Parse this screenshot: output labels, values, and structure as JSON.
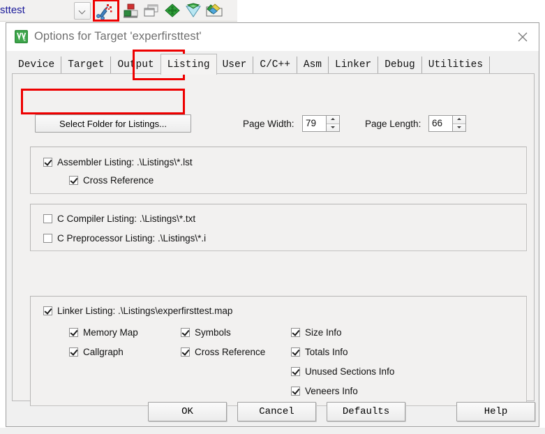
{
  "toolbar": {
    "target_combo_value": "sttest",
    "dropdown_icon": "chevron-down-icon",
    "icons": [
      {
        "name": "target-options-wand-icon",
        "highlighted": true
      },
      {
        "name": "manage-project-items-icon",
        "highlighted": false
      },
      {
        "name": "multi-project-icon",
        "highlighted": false
      },
      {
        "name": "pack-installer-green-icon",
        "highlighted": false
      },
      {
        "name": "configuration-wizard-icon",
        "highlighted": false
      },
      {
        "name": "open-pack-folder-icon",
        "highlighted": false
      }
    ]
  },
  "dialog": {
    "icon": "uvision-app-icon",
    "title": "Options for Target 'experfirsttest'",
    "close_label": "close-icon",
    "tabs": [
      {
        "label": "Device",
        "selected": false
      },
      {
        "label": "Target",
        "selected": false
      },
      {
        "label": "Output",
        "selected": false
      },
      {
        "label": "Listing",
        "selected": true
      },
      {
        "label": "User",
        "selected": false
      },
      {
        "label": "C/C++",
        "selected": false
      },
      {
        "label": "Asm",
        "selected": false
      },
      {
        "label": "Linker",
        "selected": false
      },
      {
        "label": "Debug",
        "selected": false
      },
      {
        "label": "Utilities",
        "selected": false
      }
    ],
    "listing": {
      "select_folder_button": "Select Folder for Listings...",
      "page_width_label": "Page Width:",
      "page_width_value": "79",
      "page_length_label": "Page Length:",
      "page_length_value": "66",
      "assembler_group": {
        "assembler_listing_label": "Assembler Listing:  .\\Listings\\*.lst",
        "assembler_listing_checked": true,
        "cross_reference_label": "Cross Reference",
        "cross_reference_checked": true
      },
      "compiler_group": {
        "c_compiler_listing_label": "C Compiler Listing:  .\\Listings\\*.txt",
        "c_compiler_listing_checked": false,
        "c_preprocessor_listing_label": "C Preprocessor Listing:  .\\Listings\\*.i",
        "c_preprocessor_listing_checked": false
      },
      "linker_group": {
        "linker_listing_label": "Linker Listing:  .\\Listings\\experfirsttest.map",
        "linker_listing_checked": true,
        "memory_map_label": "Memory Map",
        "memory_map_checked": true,
        "callgraph_label": "Callgraph",
        "callgraph_checked": true,
        "symbols_label": "Symbols",
        "symbols_checked": true,
        "cross_reference_label": "Cross Reference",
        "cross_reference_checked": true,
        "size_info_label": "Size Info",
        "size_info_checked": true,
        "totals_info_label": "Totals Info",
        "totals_info_checked": true,
        "unused_sections_info_label": "Unused Sections Info",
        "unused_sections_info_checked": true,
        "veneers_info_label": "Veneers Info",
        "veneers_info_checked": true
      }
    },
    "buttons": {
      "ok": "OK",
      "cancel": "Cancel",
      "defaults": "Defaults",
      "help": "Help"
    }
  },
  "highlights": {
    "color": "#ee0000",
    "regions": [
      "toolbar-target-options-icon",
      "listing-tab",
      "select-folder-for-listings-button"
    ]
  }
}
